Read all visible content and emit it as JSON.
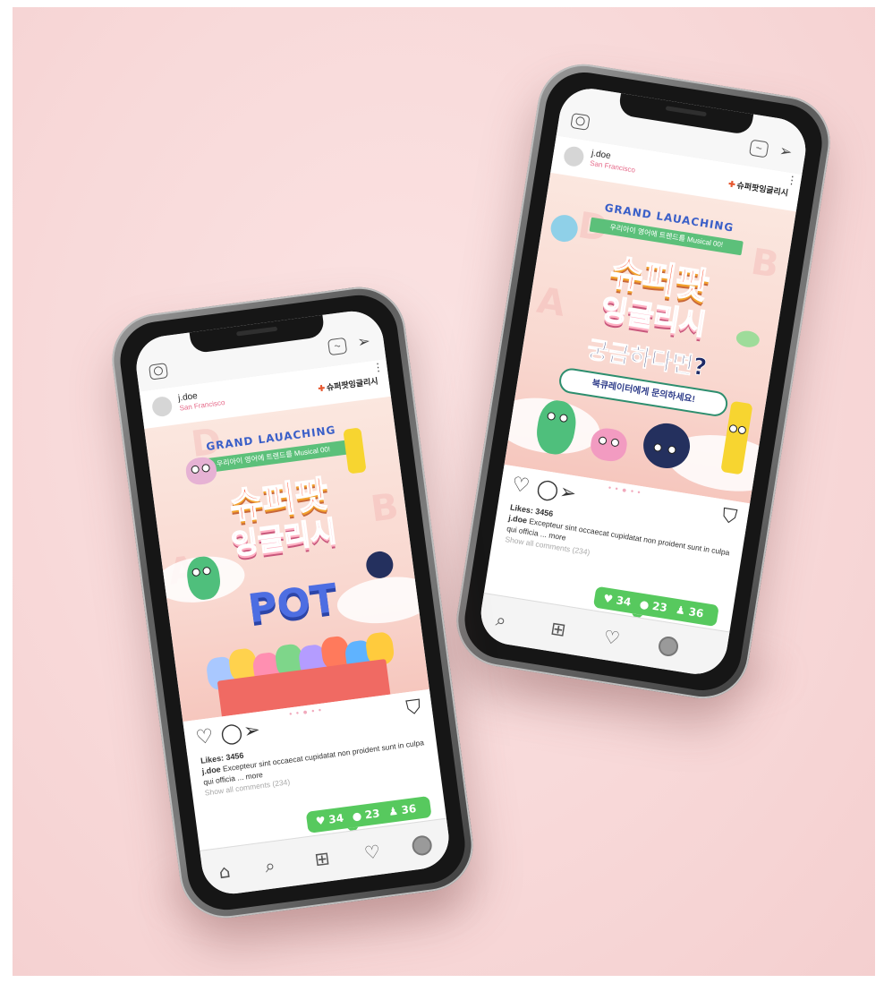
{
  "phones": {
    "front": {
      "user": {
        "name": "j.doe",
        "location": "San Francisco"
      },
      "brand": "슈퍼팟잉글리시",
      "post": {
        "headline": "GRAND LAUACHING",
        "ribbon": "우리아이 영어에 트렌드를 Musical 00!",
        "title_line1": "슈퍼팟",
        "title_line2": "잉글리시",
        "word": "POT"
      },
      "pager": "• • ● • •",
      "likes": "Likes: 3456",
      "caption_user": "j.doe",
      "caption_text": "Excepteur sint occaecat cupidatat non proident sunt in culpa qui officia ... more",
      "comments_link": "Show all comments (234)",
      "notification": {
        "likes": "34",
        "comments": "23",
        "followers": "36"
      }
    },
    "back": {
      "user": {
        "name": "j.doe",
        "location": "San Francisco"
      },
      "brand": "슈퍼팟잉글리시",
      "post": {
        "headline": "GRAND LAUACHING",
        "ribbon": "우리아이 영어에 트렌드를 Musical 00!",
        "title_line1": "슈퍼팟",
        "title_line2": "잉글리시",
        "question": "궁금하다면?",
        "bubble": "북큐레이터에게 문의하세요!"
      },
      "pager": "• • ● • •",
      "likes": "Likes: 3456",
      "caption_user": "j.doe",
      "caption_text": "Excepteur sint occaecat cupidatat non proident sunt in culpa qui officia ... more",
      "comments_link": "Show all comments (234)",
      "notification": {
        "likes": "34",
        "comments": "23",
        "followers": "36"
      }
    }
  },
  "icons": {
    "camera": "camera-icon",
    "igtv": "igtv-icon",
    "direct": "paper-plane-icon",
    "more": "more-vertical-icon",
    "like": "heart-icon",
    "comment": "comment-icon",
    "share": "paper-plane-icon",
    "save": "bookmark-icon",
    "home": "home-icon",
    "search": "search-icon",
    "add": "add-post-icon",
    "activity": "heart-icon",
    "profile": "profile-icon"
  },
  "colors": {
    "background": "#f8d9d9",
    "notification": "#57c95e",
    "title_orange": "#ff5a3c",
    "title_pink": "#ff6b8b",
    "headline_blue": "#3a5fc8"
  }
}
